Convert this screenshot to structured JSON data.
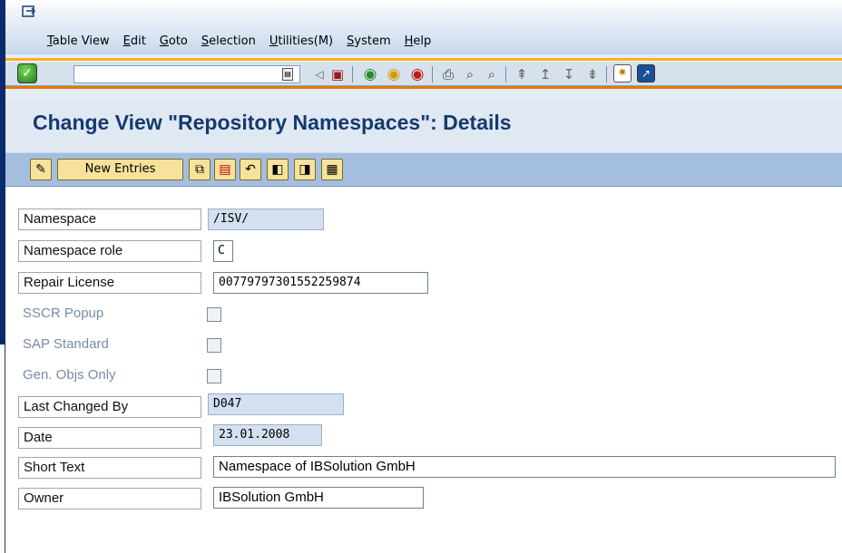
{
  "menubar": {
    "items": [
      "Table View",
      "Edit",
      "Goto",
      "Selection",
      "Utilities(M)",
      "System",
      "Help"
    ]
  },
  "toolbar": {
    "command_value": "",
    "icons": [
      "enter-icon",
      "back-arrow-icon",
      "save-icon",
      "back-icon",
      "exit-icon",
      "cancel-icon",
      "print-icon",
      "find-icon",
      "find-next-icon",
      "first-page-icon",
      "previous-page-icon",
      "next-page-icon",
      "last-page-icon",
      "create-session-icon",
      "shortcut-icon"
    ]
  },
  "title": "Change View \"Repository Namespaces\": Details",
  "app_toolbar": {
    "new_entries_label": "New Entries",
    "icons": [
      "display-change-icon",
      "copy-icon",
      "delete-icon",
      "undo-icon",
      "previous-entry-icon",
      "next-entry-icon",
      "select-all-icon"
    ]
  },
  "form": {
    "namespace": {
      "label": "Namespace",
      "value": "/ISV/"
    },
    "namespace_role": {
      "label": "Namespace role",
      "value": "C"
    },
    "repair_license": {
      "label": "Repair License",
      "value": "00779797301552259874"
    },
    "sscr_popup": {
      "label": "SSCR Popup",
      "checked": false
    },
    "sap_standard": {
      "label": "SAP Standard",
      "checked": false
    },
    "gen_objs_only": {
      "label": "Gen. Objs Only",
      "checked": false
    },
    "last_changed_by": {
      "label": "Last Changed By",
      "value": "D047"
    },
    "date": {
      "label": "Date",
      "value": "23.01.2008"
    },
    "short_text": {
      "label": "Short Text",
      "value": "Namespace of IBSolution GmbH"
    },
    "owner": {
      "label": "Owner",
      "value": "IBSolution GmbH"
    }
  },
  "colors": {
    "title": "#163a6e",
    "toolbar_accent": "#ff9800",
    "app_toolbar": "#a4bedf",
    "readonly_field": "#d3e0ef",
    "button_face": "#f6e29b"
  }
}
